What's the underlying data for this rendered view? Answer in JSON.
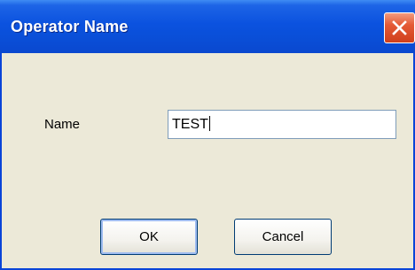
{
  "window": {
    "title": "Operator Name",
    "close_icon": "close-icon"
  },
  "form": {
    "name_label": "Name",
    "name_value": "TEST"
  },
  "buttons": {
    "ok_label": "OK",
    "cancel_label": "Cancel"
  },
  "colors": {
    "titlebar": "#0a4fd8",
    "dialog_background": "#ece9d8",
    "close_button": "#e45a36"
  }
}
